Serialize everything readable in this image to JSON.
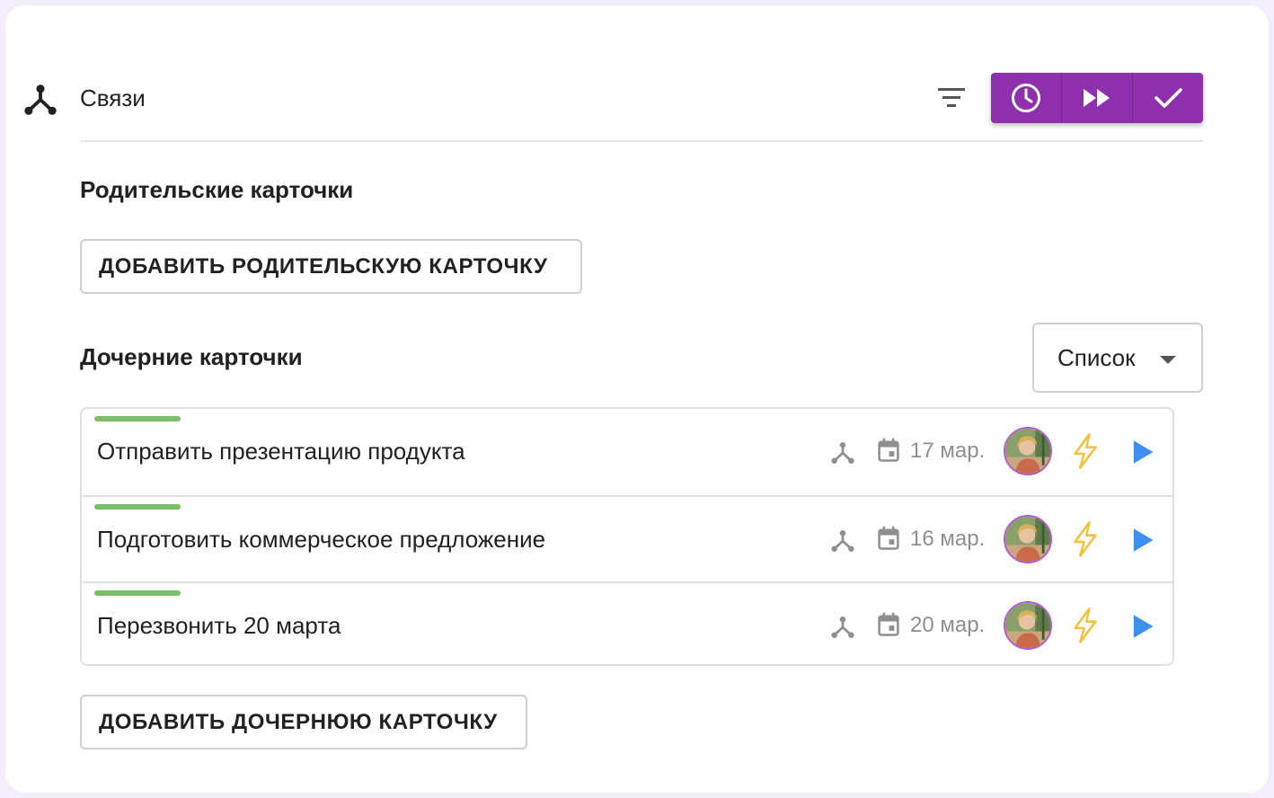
{
  "header": {
    "title": "Связи",
    "icons": {
      "links": "share-nodes-icon",
      "filter": "filter-icon",
      "history": "clock-icon",
      "forward": "fast-forward-icon",
      "done": "check-icon"
    }
  },
  "colors": {
    "accent": "#8e2fae",
    "progress": "#7cbf6b",
    "play": "#3f8ff0",
    "bolt": "#f2c23c",
    "muted": "#8f8f8f"
  },
  "parents": {
    "heading": "Родительские карточки",
    "add_label": "ДОБАВИТЬ РОДИТЕЛЬСКУЮ КАРТОЧКУ"
  },
  "children": {
    "heading": "Дочерние карточки",
    "view_select": {
      "value": "Список"
    },
    "items": [
      {
        "title": "Отправить презентацию продукта",
        "date": "17 мар."
      },
      {
        "title": "Подготовить коммерческое предложение",
        "date": "16 мар."
      },
      {
        "title": "Перезвонить 20 марта",
        "date": "20 мар."
      }
    ],
    "row_icons": [
      "subtasks-icon",
      "calendar-icon",
      "avatar",
      "lightning-icon",
      "play-icon"
    ],
    "add_label": "ДОБАВИТЬ ДОЧЕРНЮЮ КАРТОЧКУ"
  }
}
